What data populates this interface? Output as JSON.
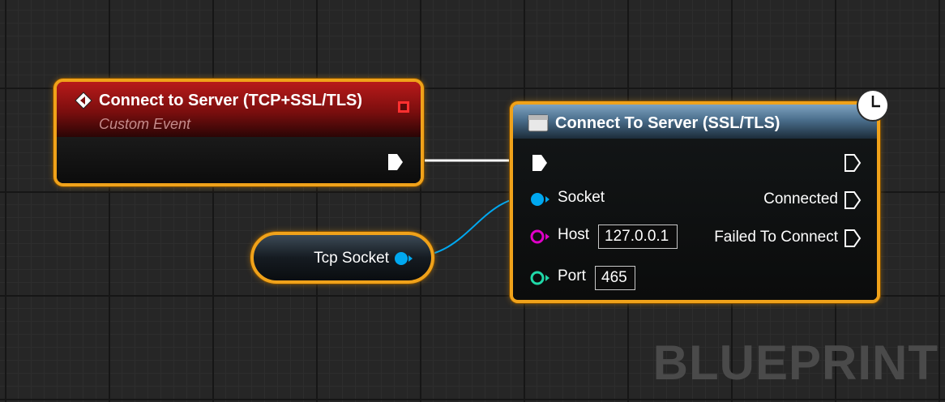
{
  "event_node": {
    "title": "Connect to Server (TCP+SSL/TLS)",
    "subtitle": "Custom Event",
    "icon": "event-diamond-icon"
  },
  "variable_node": {
    "label": "Tcp Socket"
  },
  "function_node": {
    "title": "Connect To Server (SSL/TLS)",
    "icon": "function-icon",
    "inputs": {
      "socket_label": "Socket",
      "host_label": "Host",
      "host_value": "127.0.0.1",
      "port_label": "Port",
      "port_value": "465"
    },
    "outputs": {
      "connected_label": "Connected",
      "failed_label": "Failed To Connect"
    },
    "latent_icon": "clock-icon"
  },
  "watermark": "BLUEPRINT",
  "colors": {
    "selection": "#f0a21a",
    "object_pin": "#00a8f0",
    "string_pin": "#e000c8",
    "integer_pin": "#20d8a8",
    "exec_pin": "#ffffff",
    "delegate_pin": "#ff3030"
  }
}
